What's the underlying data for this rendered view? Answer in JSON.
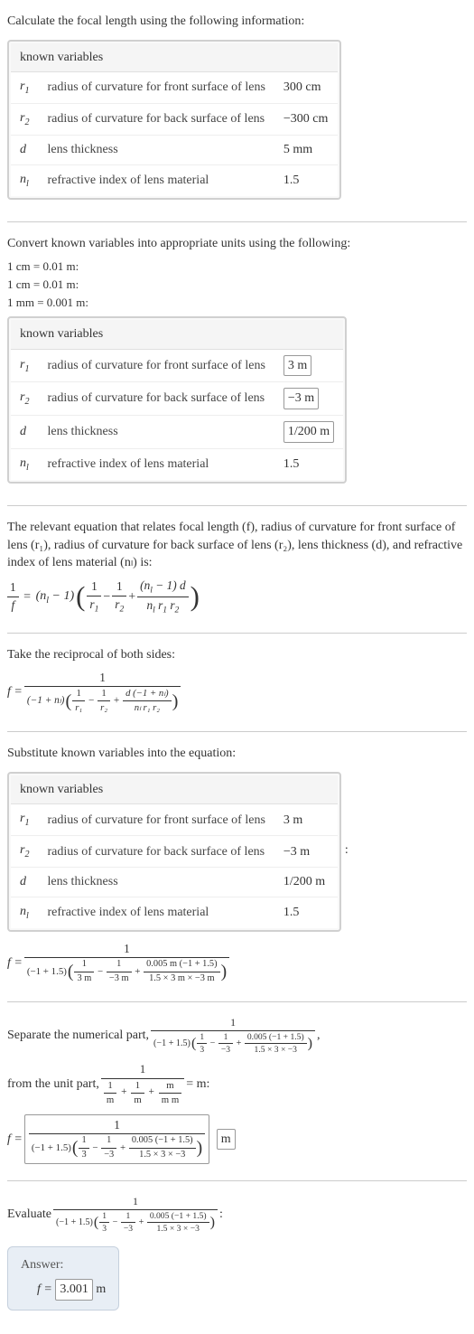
{
  "intro": "Calculate the focal length using the following information:",
  "table_header": "known variables",
  "rows": {
    "r1_sym_base": "r",
    "r1_sym_sub": "1",
    "r1_desc": "radius of curvature for front surface of lens",
    "r2_sym_base": "r",
    "r2_sym_sub": "2",
    "r2_desc": "radius of curvature for back surface of lens",
    "d_sym": "d",
    "d_desc": "lens thickness",
    "nl_sym_base": "n",
    "nl_sym_sub": "l",
    "nl_desc": "refractive index of lens material"
  },
  "vals1": {
    "r1": "300 cm",
    "r2": "−300 cm",
    "d": "5 mm",
    "nl": "1.5"
  },
  "convert_intro": "Convert known variables into appropriate units using the following:",
  "conv1": "1 cm = 0.01 m:",
  "conv2": "1 cm = 0.01 m:",
  "conv3": "1 mm = 0.001 m:",
  "vals2": {
    "r1": "3 m",
    "r2": "−3 m",
    "d": "1/200 m",
    "nl": "1.5"
  },
  "relevant_eq_text": "The relevant equation that relates focal length (f), radius of curvature for front surface of lens (r₁), radius of curvature for back surface of lens (r₂), lens thickness (d), and refractive index of lens material (nₗ) is:",
  "eq1": {
    "lhs_num": "1",
    "lhs_den": "f",
    "coef_pre": "(n",
    "coef_sub": "l",
    "coef_post": " − 1)",
    "t1_num": "1",
    "t1_den_base": "r",
    "t1_den_sub": "1",
    "minus": " − ",
    "t2_num": "1",
    "t2_den_base": "r",
    "t2_den_sub": "2",
    "plus": " + ",
    "t3_num_l": "(n",
    "t3_num_sub": "l",
    "t3_num_r": " − 1) d",
    "t3_den_a": "n",
    "t3_den_a_sub": "l",
    "t3_den_b": " r",
    "t3_den_b_sub": "1",
    "t3_den_c": " r",
    "t3_den_c_sub": "2"
  },
  "recip_text": "Take the reciprocal of both sides:",
  "eq2": {
    "lhs": "f = ",
    "num": "1",
    "coef": "(−1 + nₗ)",
    "t1n": "1",
    "t1d": "r₁",
    "t2n": "1",
    "t2d": "r₂",
    "t3n": "d (−1 + nₗ)",
    "t3d": "nₗ r₁ r₂"
  },
  "subst_text": "Substitute known variables into the equation:",
  "vals3": {
    "r1": "3 m",
    "r2": "−3 m",
    "d": "1/200 m",
    "nl": "1.5"
  },
  "eq3": {
    "lhs": "f = ",
    "num": "1",
    "coef": "(−1 + 1.5)",
    "t1n": "1",
    "t1d": "3 m",
    "t2n": "1",
    "t2d": "−3 m",
    "t3n": "0.005 m (−1 + 1.5)",
    "t3d": "1.5 × 3 m × −3 m"
  },
  "sep_text_a": "Separate the numerical part, ",
  "sep_text_b": ",",
  "sep_text_c": "from the unit part, ",
  "sep_text_d": " = m:",
  "sep_num": {
    "num": "1",
    "coef": "(−1 + 1.5)",
    "t1n": "1",
    "t1d": "3",
    "t2n": "1",
    "t2d": "−3",
    "t3n": "0.005 (−1 + 1.5)",
    "t3d": "1.5 × 3 × −3"
  },
  "sep_unit": {
    "num": "1",
    "t1n": "1",
    "t1d": "m",
    "t2n": "1",
    "t2d": "m",
    "t3n": "m",
    "t3d": "m m"
  },
  "eq4": {
    "lhs": "f = ",
    "num": "1",
    "coef": "(−1 + 1.5)",
    "t1n": "1",
    "t1d": "3",
    "t2n": "1",
    "t2d": "−3",
    "t3n": "0.005 (−1 + 1.5)",
    "t3d": "1.5 × 3 × −3",
    "unit": "m"
  },
  "eval_text": "Evaluate ",
  "eval_after": ":",
  "answer_label": "Answer:",
  "answer_eq_lhs": "f = ",
  "answer_val": "3.001",
  "answer_unit": " m"
}
